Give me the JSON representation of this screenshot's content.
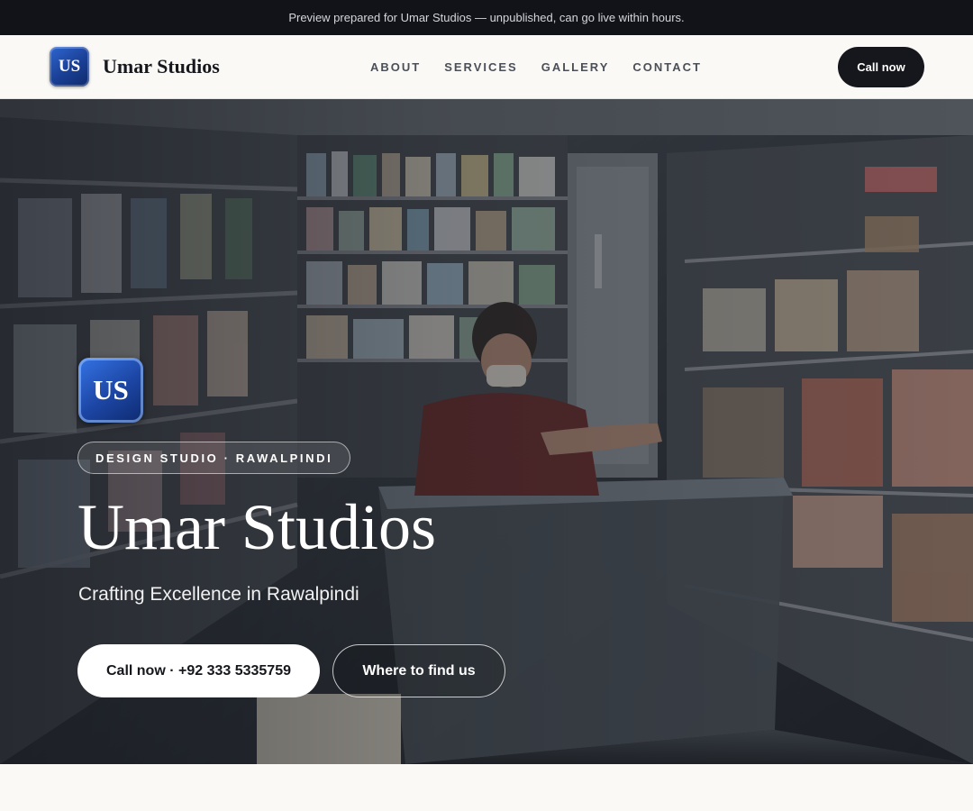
{
  "preview_banner": {
    "text": "Preview prepared for Umar Studios — unpublished, can go live within hours."
  },
  "nav": {
    "logo_initials": "US",
    "brand_name": "Umar Studios",
    "links": [
      {
        "label": "ABOUT"
      },
      {
        "label": "SERVICES"
      },
      {
        "label": "GALLERY"
      },
      {
        "label": "CONTACT"
      }
    ],
    "call_label": "Call now"
  },
  "hero": {
    "logo_initials": "US",
    "tagline": "DESIGN STUDIO · RAWALPINDI",
    "title": "Umar Studios",
    "subtitle": "Crafting Excellence in Rawalpindi",
    "primary_button": "Call now · +92 333 5335759",
    "secondary_button": "Where to find us"
  },
  "colors": {
    "banner_bg": "#111318",
    "accent_dark": "#15171c",
    "logo_blue": "#1c45a3",
    "page_bg": "#faf9f6"
  }
}
